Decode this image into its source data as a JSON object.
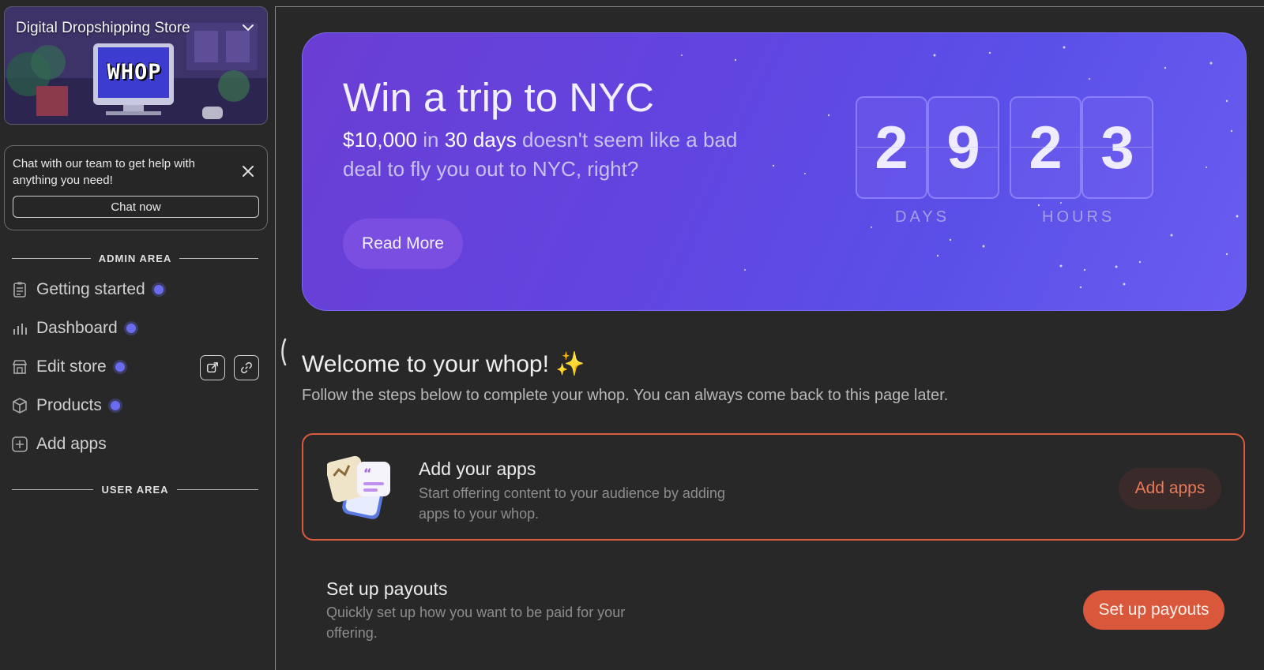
{
  "sidebar": {
    "store_name": "Digital Dropshipping Store",
    "store_logo_text": "WHOP",
    "chat": {
      "text": "Chat with our team to get help with anything you need!",
      "button": "Chat now"
    },
    "admin_label": "ADMIN AREA",
    "user_label": "USER AREA",
    "items": [
      {
        "label": "Getting started",
        "icon": "clipboard-checklist-icon",
        "dot": true
      },
      {
        "label": "Dashboard",
        "icon": "bar-chart-icon",
        "dot": true
      },
      {
        "label": "Edit store",
        "icon": "storefront-icon",
        "dot": true
      },
      {
        "label": "Products",
        "icon": "box-icon",
        "dot": true
      },
      {
        "label": "Add apps",
        "icon": "plus-square-icon",
        "dot": false
      }
    ]
  },
  "banner": {
    "title": "Win a trip to NYC",
    "amount": "$10,000",
    "in": "in",
    "days_phrase": "30 days",
    "rest": "doesn't seem like a bad deal to fly you out to NYC, right?",
    "button": "Read More",
    "countdown": {
      "days": [
        "2",
        "9"
      ],
      "hours": [
        "2",
        "3"
      ],
      "days_label": "DAYS",
      "hours_label": "HOURS"
    },
    "colors": {
      "start": "#6a3ed4",
      "end": "#6a5cf0"
    }
  },
  "welcome": {
    "title": "Welcome to your whop! ✨",
    "subtitle": "Follow the steps below to complete your whop. You can always come back to this page later."
  },
  "steps": [
    {
      "title": "Add your apps",
      "description": "Start offering content to your audience by adding apps to your whop.",
      "button": "Add apps",
      "accent": "#d95a3c"
    },
    {
      "title": "Set up payouts",
      "description": "Quickly set up how you want to be paid for your offering.",
      "button": "Set up payouts",
      "accent": "#d9573a"
    }
  ]
}
